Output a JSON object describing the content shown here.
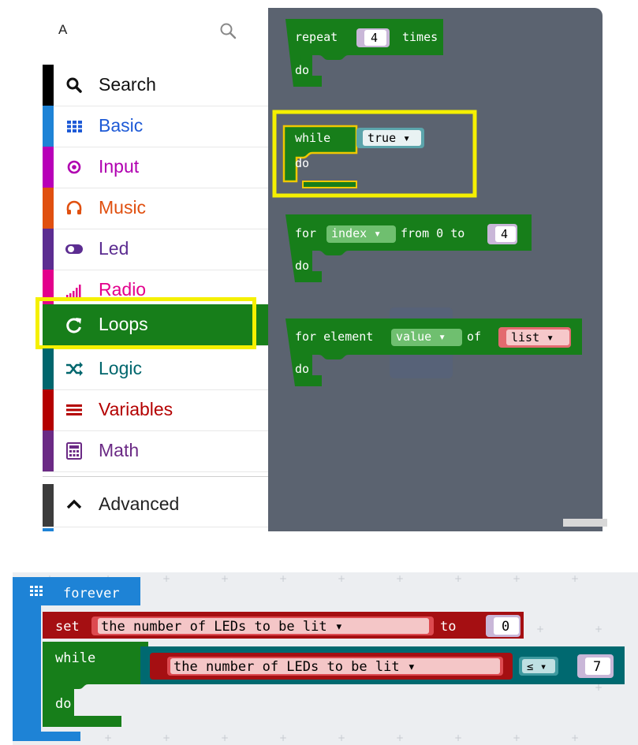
{
  "toolbox": {
    "search_query": "A",
    "categories": [
      {
        "label": "Search",
        "icon": "search-icon",
        "color": "#000000"
      },
      {
        "label": "Basic",
        "icon": "grid-icon",
        "color": "#1e90ff"
      },
      {
        "label": "Input",
        "icon": "input-target-icon",
        "color": "#d400d4"
      },
      {
        "label": "Music",
        "icon": "headphones-icon",
        "color": "#e63022"
      },
      {
        "label": "Led",
        "icon": "toggle-icon",
        "color": "#5c2d91"
      },
      {
        "label": "Radio",
        "icon": "signal-bars-icon",
        "color": "#e3008c"
      },
      {
        "label": "Loops",
        "icon": "refresh-icon",
        "color": "#00aa00",
        "selected": true
      },
      {
        "label": "Logic",
        "icon": "shuffle-icon",
        "color": "#006970"
      },
      {
        "label": "Variables",
        "icon": "list-icon",
        "color": "#dc143c"
      },
      {
        "label": "Math",
        "icon": "calculator-icon",
        "color": "#65317b"
      },
      {
        "label": "Advanced",
        "icon": "chevron-up-icon",
        "color": "#3c3c3c"
      }
    ]
  },
  "flyout": {
    "repeat_block": {
      "kw_repeat": "repeat",
      "count": "4",
      "kw_times": "times",
      "kw_do": "do"
    },
    "while_block": {
      "kw_while": "while",
      "condition": "true ▾",
      "kw_do": "do"
    },
    "for_block": {
      "kw_for": "for",
      "var": "index ▾",
      "kw_from": "from 0 to",
      "to": "4",
      "kw_do": "do"
    },
    "foreach_block": {
      "kw_for": "for element",
      "var": "value ▾",
      "kw_of": "of",
      "list": "list ▾",
      "kw_do": "do"
    }
  },
  "workspace": {
    "forever_label": "forever",
    "set_block": {
      "kw_set": "set",
      "var": "the number of LEDs to be lit ▾",
      "kw_to": "to",
      "value": "0"
    },
    "while_block": {
      "kw_while": "while",
      "lhs": "the number of LEDs to be lit ▾",
      "op": "≤ ▾",
      "rhs": "7",
      "kw_do": "do"
    }
  },
  "colors": {
    "loops": "#177e1a",
    "variables": "#a50f12",
    "logic": "#006970",
    "basic": "#1e83d6",
    "flyout_bg": "#5b6370",
    "highlight": "#f5f000"
  }
}
